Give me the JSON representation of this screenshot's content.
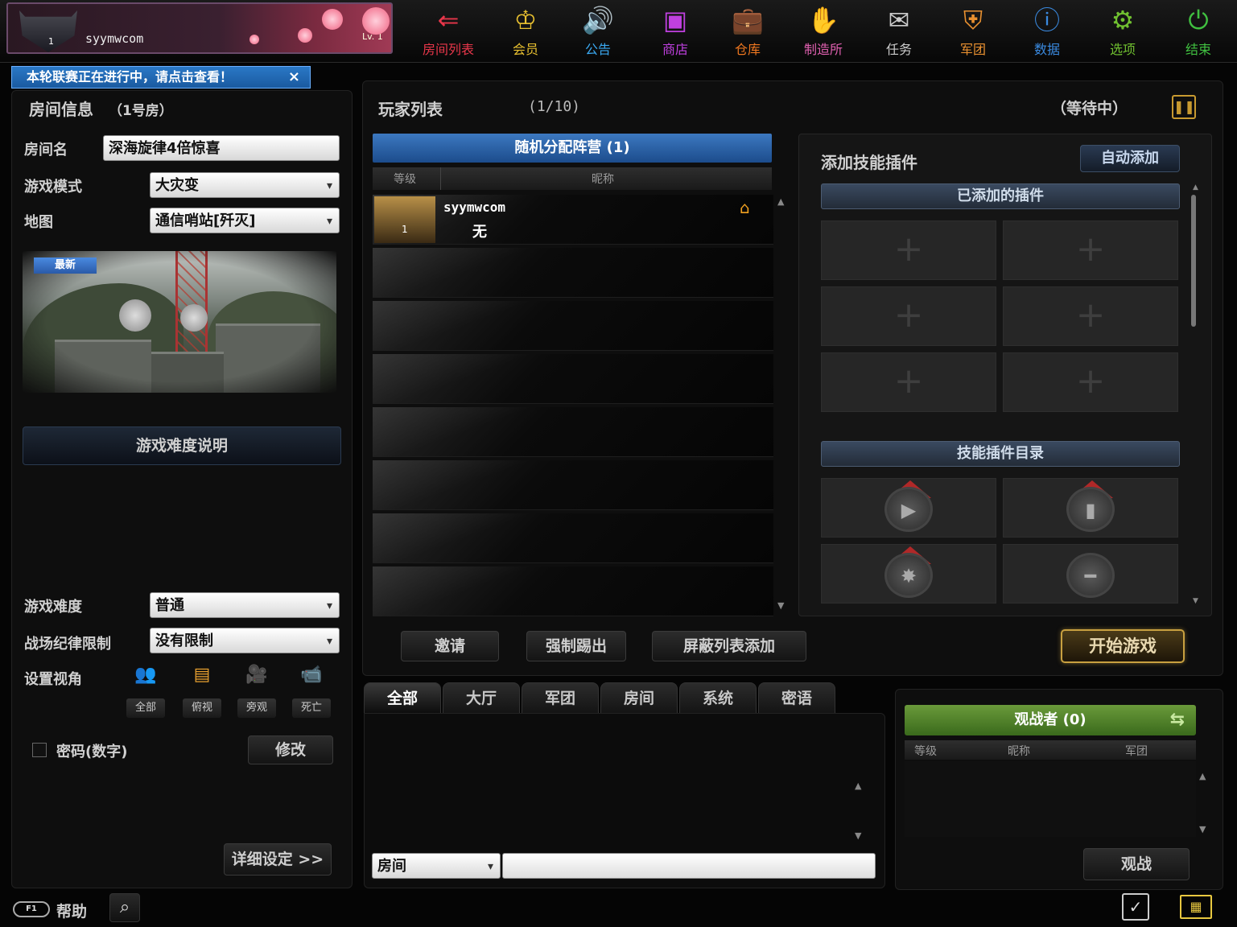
{
  "profile": {
    "username": "syymwcom",
    "rank_number": "1",
    "level_tag": "Lv. 1"
  },
  "nav": [
    {
      "label": "房间列表",
      "icon": "arrow-left-icon",
      "glyph": "⇐",
      "color": "#e8364a"
    },
    {
      "label": "会员",
      "icon": "crown-icon",
      "glyph": "♔",
      "color": "#e8c030"
    },
    {
      "label": "公告",
      "icon": "speaker-icon",
      "glyph": "🔊",
      "color": "#3aa8f0"
    },
    {
      "label": "商店",
      "icon": "shop-icon",
      "glyph": "▣",
      "color": "#c040e0"
    },
    {
      "label": "仓库",
      "icon": "briefcase-icon",
      "glyph": "💼",
      "color": "#f07820"
    },
    {
      "label": "制造所",
      "icon": "glove-icon",
      "glyph": "✋",
      "color": "#e060b0"
    },
    {
      "label": "任务",
      "icon": "ticket-icon",
      "glyph": "✉",
      "color": "#cccccc"
    },
    {
      "label": "军团",
      "icon": "shield-icon",
      "glyph": "⛨",
      "color": "#e89030"
    },
    {
      "label": "数据",
      "icon": "info-icon",
      "glyph": "ⓘ",
      "color": "#3a8ae0"
    },
    {
      "label": "选项",
      "icon": "gear-icon",
      "glyph": "⚙",
      "color": "#70c030"
    },
    {
      "label": "结束",
      "icon": "power-icon",
      "glyph": "⏻",
      "color": "#40c040"
    }
  ],
  "announcement": {
    "text": "本轮联赛正在进行中，请点击查看！",
    "close": "×"
  },
  "room": {
    "title": "房间信息",
    "number": "（1号房）",
    "name_label": "房间名",
    "name_value": "深海旋律4倍惊喜",
    "mode_label": "游戏模式",
    "mode_value": "大灾变",
    "map_label": "地图",
    "map_value": "通信哨站[歼灭]",
    "new_tag": "最新",
    "difficulty_info_button": "游戏难度说明",
    "difficulty_label": "游戏难度",
    "difficulty_value": "普通",
    "discipline_label": "战场纪律限制",
    "discipline_value": "没有限制",
    "view_label": "设置视角",
    "views": [
      {
        "label": "全部",
        "icon": "people-icon",
        "glyph": "👥"
      },
      {
        "label": "俯视",
        "icon": "overhead-view-icon",
        "glyph": "▤"
      },
      {
        "label": "旁观",
        "icon": "camera-icon",
        "glyph": "🎥"
      },
      {
        "label": "死亡",
        "icon": "video-camera-icon",
        "glyph": "📹"
      }
    ],
    "password_label": "密码(数字)",
    "modify_button": "修改",
    "advanced_button": "详细设定 >>"
  },
  "players": {
    "title": "玩家列表",
    "count": "(1/10)",
    "status": "（等待中）",
    "team_bar": "随机分配阵营 (1)",
    "col_level": "等级",
    "col_name": "昵称",
    "rows": [
      {
        "name": "syymwcom",
        "clan": "无",
        "rank": "1"
      }
    ]
  },
  "plugins": {
    "title": "添加技能插件",
    "auto_add": "自动添加",
    "added_header": "已添加的插件",
    "catalog_header": "技能插件目录",
    "add_glyph": "+"
  },
  "actions": {
    "invite": "邀请",
    "kick": "强制踢出",
    "block": "屏蔽列表添加",
    "start": "开始游戏"
  },
  "chat": {
    "tabs": [
      "全部",
      "大厅",
      "军团",
      "房间",
      "系统",
      "密语"
    ],
    "channel": "房间",
    "input_value": ""
  },
  "spectators": {
    "title": "观战者 (0)",
    "col_level": "等级",
    "col_name": "昵称",
    "col_clan": "军团",
    "watch_button": "观战"
  },
  "footer": {
    "help": "帮助",
    "help_tag": "F1"
  }
}
